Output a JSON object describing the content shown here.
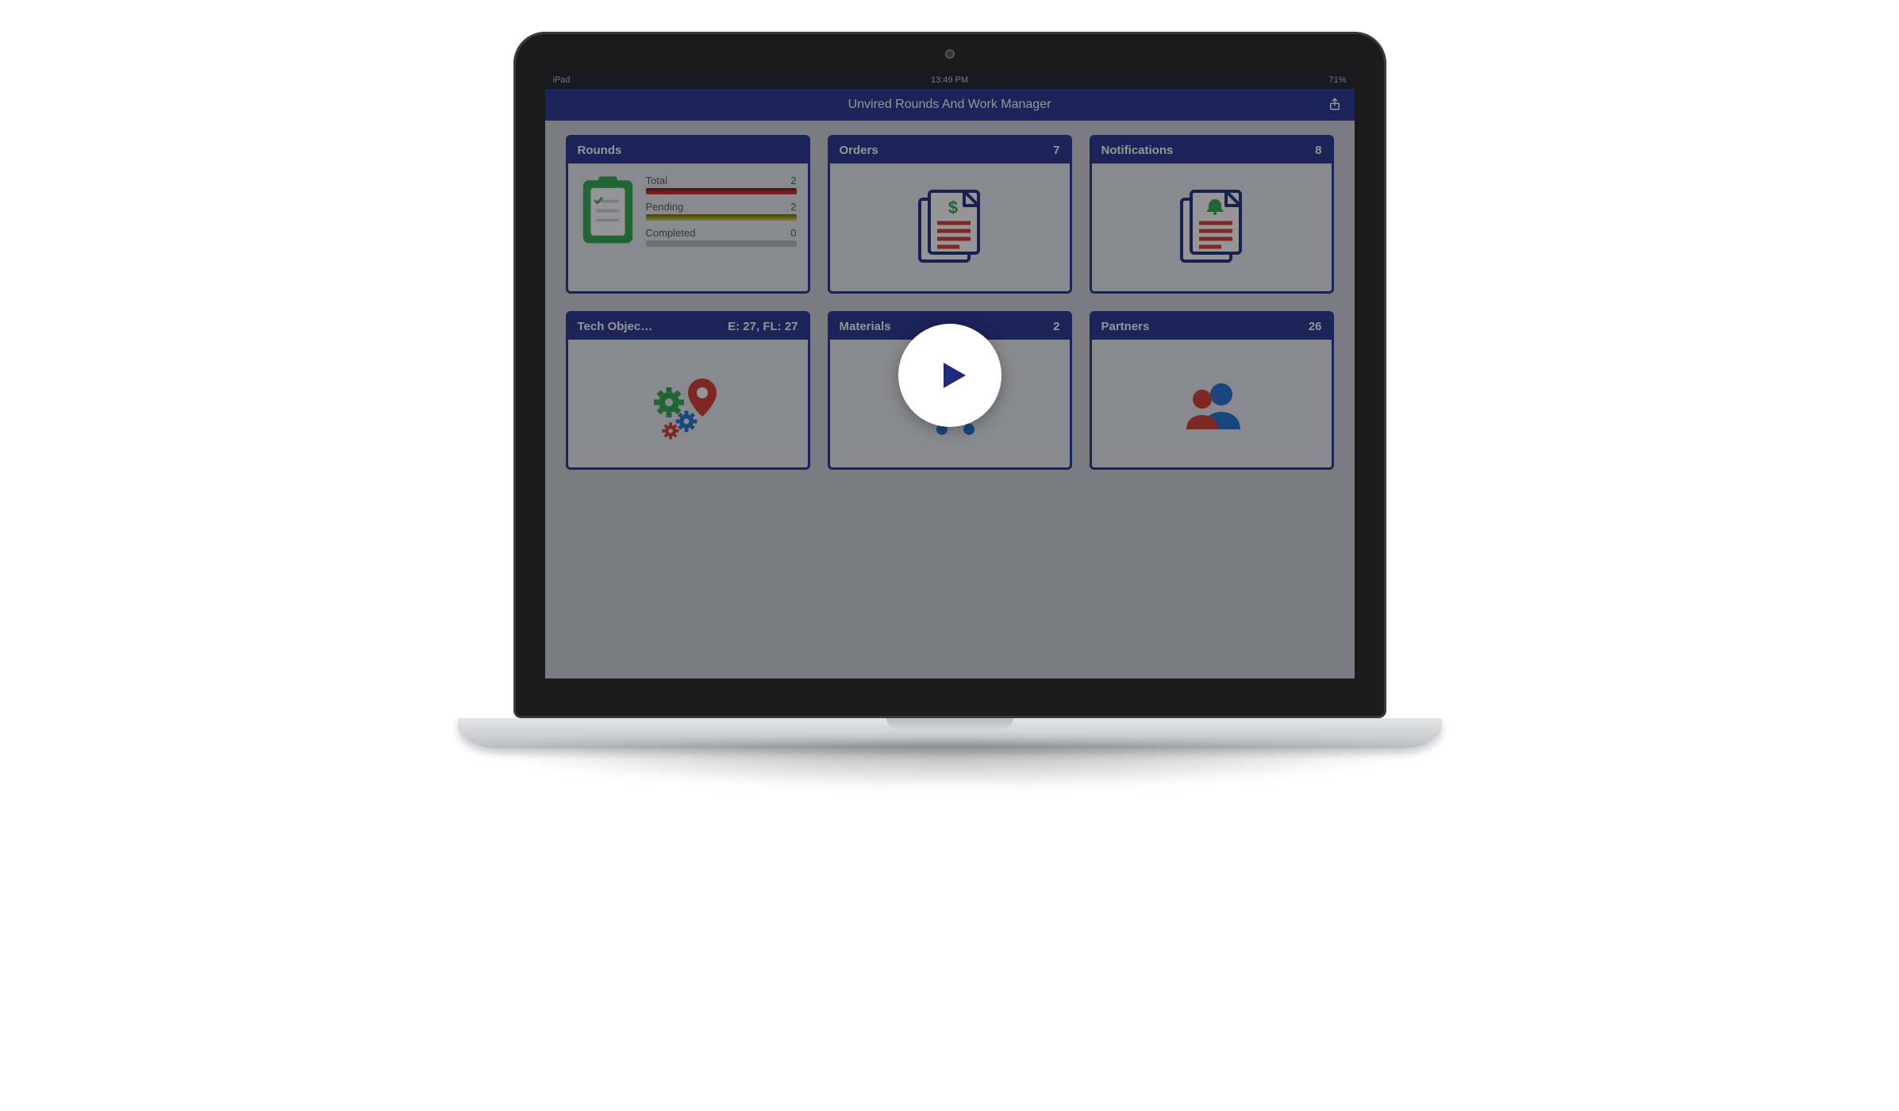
{
  "status_bar": {
    "left": "iPad",
    "time": "13:49 PM",
    "battery": "71%"
  },
  "navbar": {
    "title": "Unvired Rounds And Work Manager",
    "right_icon": "share-icon"
  },
  "cards": {
    "rounds": {
      "title": "Rounds",
      "stats": {
        "total": {
          "label": "Total",
          "value": "2"
        },
        "pending": {
          "label": "Pending",
          "value": "2"
        },
        "completed": {
          "label": "Completed",
          "value": "0"
        }
      }
    },
    "orders": {
      "title": "Orders",
      "count": "7"
    },
    "notifications": {
      "title": "Notifications",
      "count": "8"
    },
    "tech_objects": {
      "title": "Tech Objec…",
      "count": "E: 27, FL: 27"
    },
    "materials": {
      "title": "Materials",
      "count": "2"
    },
    "partners": {
      "title": "Partners",
      "count": "26"
    }
  },
  "play_button": {
    "label": "Play video"
  }
}
